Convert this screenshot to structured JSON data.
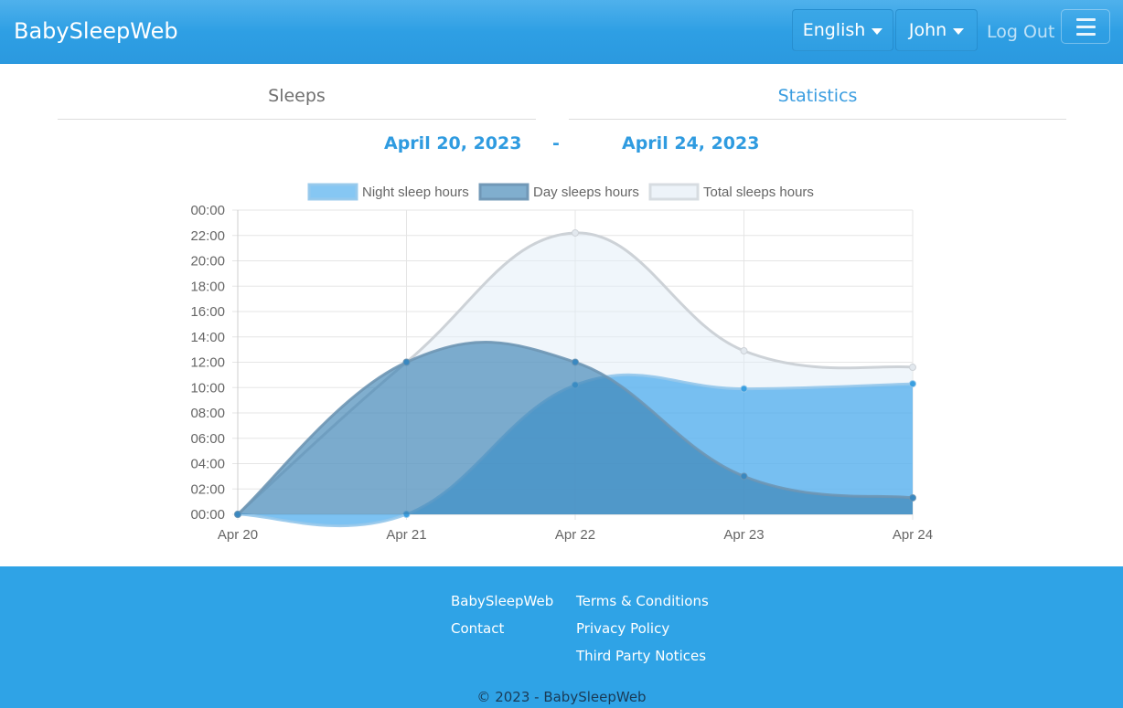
{
  "nav": {
    "brand": "BabySleepWeb",
    "language": "English",
    "user": "John",
    "logout": "Log Out",
    "menu_icon": "hamburger-icon"
  },
  "tabs": [
    {
      "label": "Sleeps",
      "active": false
    },
    {
      "label": "Statistics",
      "active": true
    }
  ],
  "date_range": {
    "from": "April 20, 2023",
    "separator": "-",
    "to": "April 24, 2023"
  },
  "chart_data": {
    "type": "area",
    "categories": [
      "Apr 20",
      "Apr 21",
      "Apr 22",
      "Apr 23",
      "Apr 24"
    ],
    "y_ticks": [
      "00:00",
      "02:00",
      "04:00",
      "06:00",
      "08:00",
      "10:00",
      "12:00",
      "14:00",
      "16:00",
      "18:00",
      "20:00",
      "22:00",
      "00:00"
    ],
    "ylim": [
      0,
      24
    ],
    "y_unit": "hours",
    "grid": true,
    "legend_position": "top",
    "series": [
      {
        "name": "Night sleep hours",
        "values": [
          0,
          0,
          10.2,
          9.9,
          10.3
        ],
        "color": "#5fb3ea"
      },
      {
        "name": "Day sleeps hours",
        "values": [
          0,
          12.0,
          12.0,
          3.0,
          1.3
        ],
        "color": "#5b9fcb"
      },
      {
        "name": "Total sleeps hours",
        "values": [
          0,
          12.0,
          22.2,
          12.9,
          11.6
        ],
        "color": "#e8eef3"
      }
    ]
  },
  "footer": {
    "col1": [
      "BabySleepWeb",
      "Contact"
    ],
    "col2": [
      "Terms & Conditions",
      "Privacy Policy",
      "Third Party Notices"
    ],
    "copyright": "© 2023 - BabySleepWeb"
  }
}
